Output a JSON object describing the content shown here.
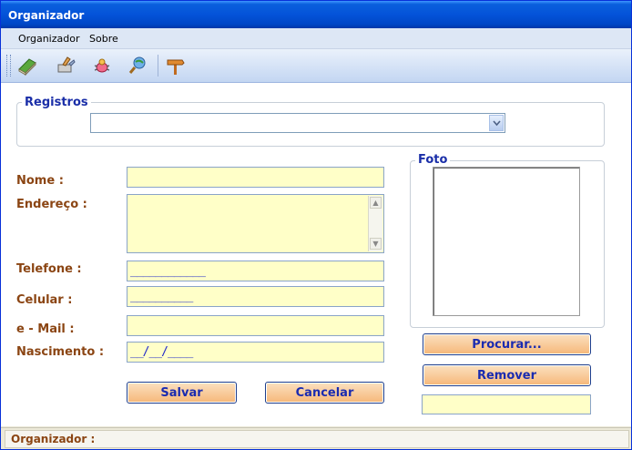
{
  "window": {
    "title": "Organizador"
  },
  "menu": {
    "items": [
      "Organizador",
      "Sobre"
    ]
  },
  "toolbar": {
    "icons": [
      "book-icon",
      "tools-icon",
      "bug-icon",
      "search-globe-icon",
      "signpost-icon"
    ]
  },
  "registros": {
    "legend": "Registros",
    "selected": ""
  },
  "form": {
    "nome_label": "Nome :",
    "endereco_label": "Endereço :",
    "telefone_label": "Telefone :",
    "telefone_mask": "____________",
    "celular_label": "Celular :",
    "celular_mask": "__________",
    "email_label": "e - Mail :",
    "nascimento_label": "Nascimento :",
    "nascimento_mask": "__/__/____"
  },
  "buttons": {
    "salvar": "Salvar",
    "cancelar": "Cancelar",
    "procurar": "Procurar...",
    "remover": "Remover"
  },
  "foto": {
    "legend": "Foto"
  },
  "status": {
    "text": "Organizador :"
  },
  "colors": {
    "title_blue": "#0453d9",
    "label_brown": "#8b4513",
    "field_yellow": "#ffffc8",
    "button_orange": "#f6b779",
    "legend_blue": "#1a2ea8"
  }
}
